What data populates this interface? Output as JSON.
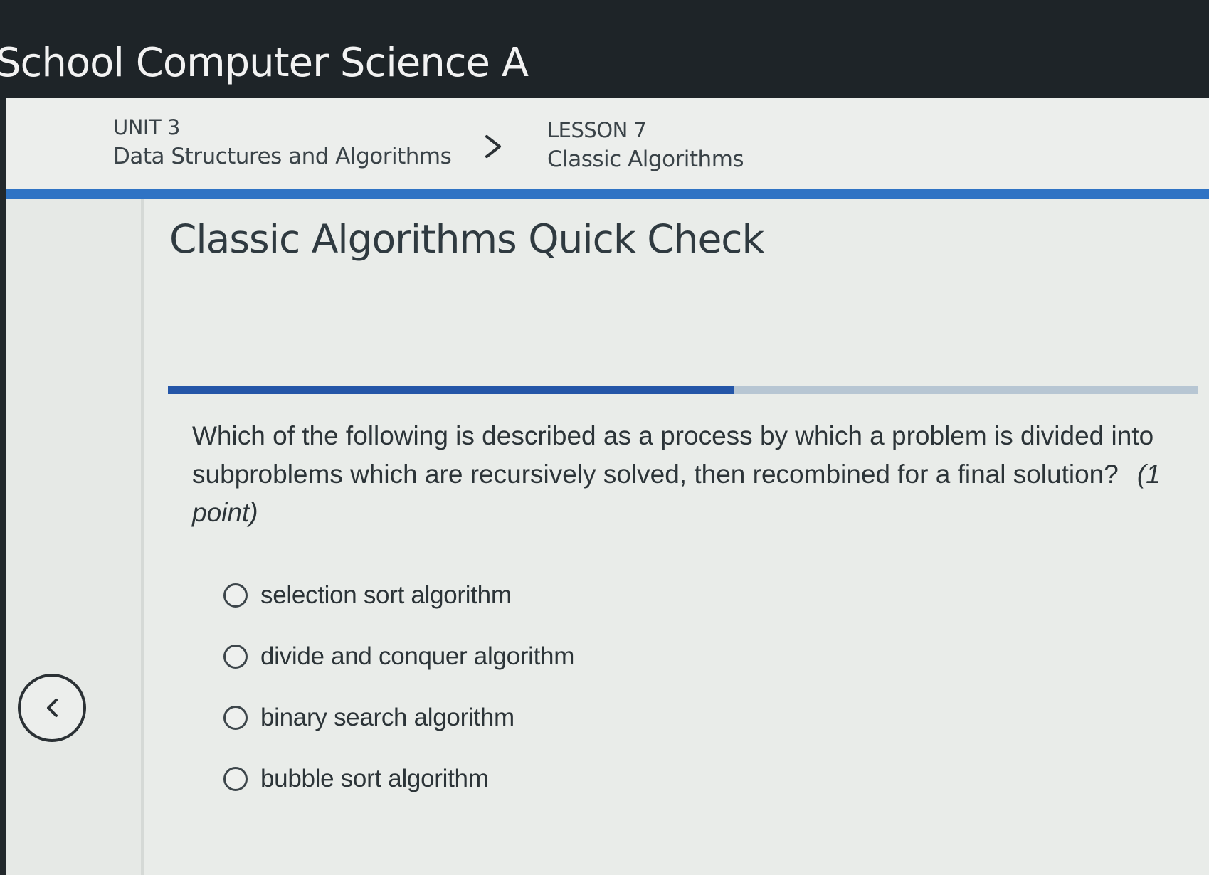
{
  "header": {
    "course_title": "School Computer Science A"
  },
  "breadcrumb": {
    "unit": {
      "kicker": "UNIT 3",
      "name": "Data Structures and Algorithms"
    },
    "separator_icon": "chevron-right-icon",
    "lesson": {
      "kicker": "LESSON 7",
      "name": "Classic Algorithms"
    }
  },
  "quiz": {
    "title": "Classic Algorithms Quick Check",
    "progress_fraction": 0.55,
    "question": {
      "text": "Which of the following is described as a process by which a problem is divided into subproblems which are recursively solved, then recombined for a final solution?",
      "points": "(1 point)"
    },
    "options": [
      "selection sort algorithm",
      "divide and conquer algorithm",
      "binary search algorithm",
      "bubble sort algorithm"
    ]
  },
  "navigation": {
    "back_icon": "chevron-left-icon"
  },
  "colors": {
    "header_bg": "#1e2428",
    "accent_blue": "#2f73c4",
    "progress_fill": "#2456a8",
    "progress_track": "#b7c6d3"
  }
}
